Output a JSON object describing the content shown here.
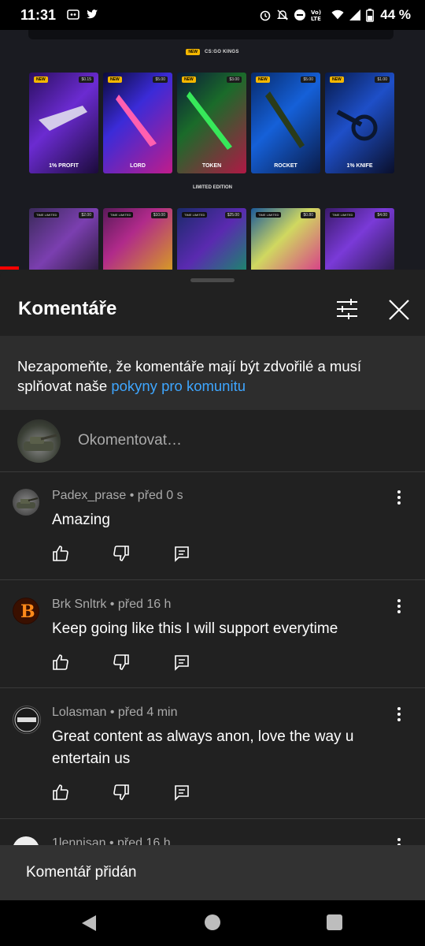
{
  "status_bar": {
    "time": "11:31",
    "battery": "44 %",
    "network": "Vo) LTE",
    "left_icons": [
      "yt-kids-icon",
      "twitter-icon"
    ],
    "right_icons": [
      "alarm-icon",
      "bell-off-icon",
      "dnd-icon",
      "volte-icon",
      "wifi-icon",
      "signal-icon",
      "battery-icon"
    ]
  },
  "video": {
    "section1_badge": "NEW",
    "section1_title": "CS:GO KINGS",
    "section2_title": "LIMITED EDITION",
    "cards_row1": [
      {
        "badge": "NEW",
        "price": "$0.15",
        "name": "1% PROFIT"
      },
      {
        "badge": "NEW",
        "price": "$5.00",
        "name": "LORD"
      },
      {
        "badge": "NEW",
        "price": "$3.00",
        "name": "TOKEN"
      },
      {
        "badge": "NEW",
        "price": "$5.00",
        "name": "ROCKET"
      },
      {
        "badge": "NEW",
        "price": "$1.00",
        "name": "1% KNIFE"
      }
    ],
    "cards_row2": [
      {
        "badge": "TIME LIMITED",
        "price": "$2.00"
      },
      {
        "badge": "TIME LIMITED",
        "price": "$10.00"
      },
      {
        "badge": "TIME LIMITED",
        "price": "$25.00"
      },
      {
        "badge": "TIME LIMITED",
        "price": "$0.80"
      },
      {
        "badge": "TIME LIMITED",
        "price": "$4.00"
      }
    ]
  },
  "comments_sheet": {
    "title": "Komentáře",
    "notice_text": "Nezapomeňte, že komentáře mají být zdvořilé a musí splňovat naše ",
    "notice_link": "pokyny pro komunitu",
    "compose_placeholder": "Okomentovat…",
    "comments": [
      {
        "author": "Padex_prase",
        "time": "před 0 s",
        "text": "Amazing"
      },
      {
        "author": "Brk Snltrk",
        "time": "před 16 h",
        "text": "Keep going like this I will support everytime"
      },
      {
        "author": "Lolasman",
        "time": "před 4 min",
        "text": "Great content as always anon, love the way u entertain us"
      },
      {
        "author": "1lennisan",
        "time": "před 16 h",
        "text": ""
      }
    ]
  },
  "toast": {
    "text": "Komentář přidán"
  },
  "nav": {
    "back": "back-icon",
    "home": "home-icon",
    "recents": "recents-icon"
  },
  "colors": {
    "background": "#212121",
    "link": "#3ea6ff",
    "progress": "#ff0000",
    "badge": "#f5b700"
  }
}
